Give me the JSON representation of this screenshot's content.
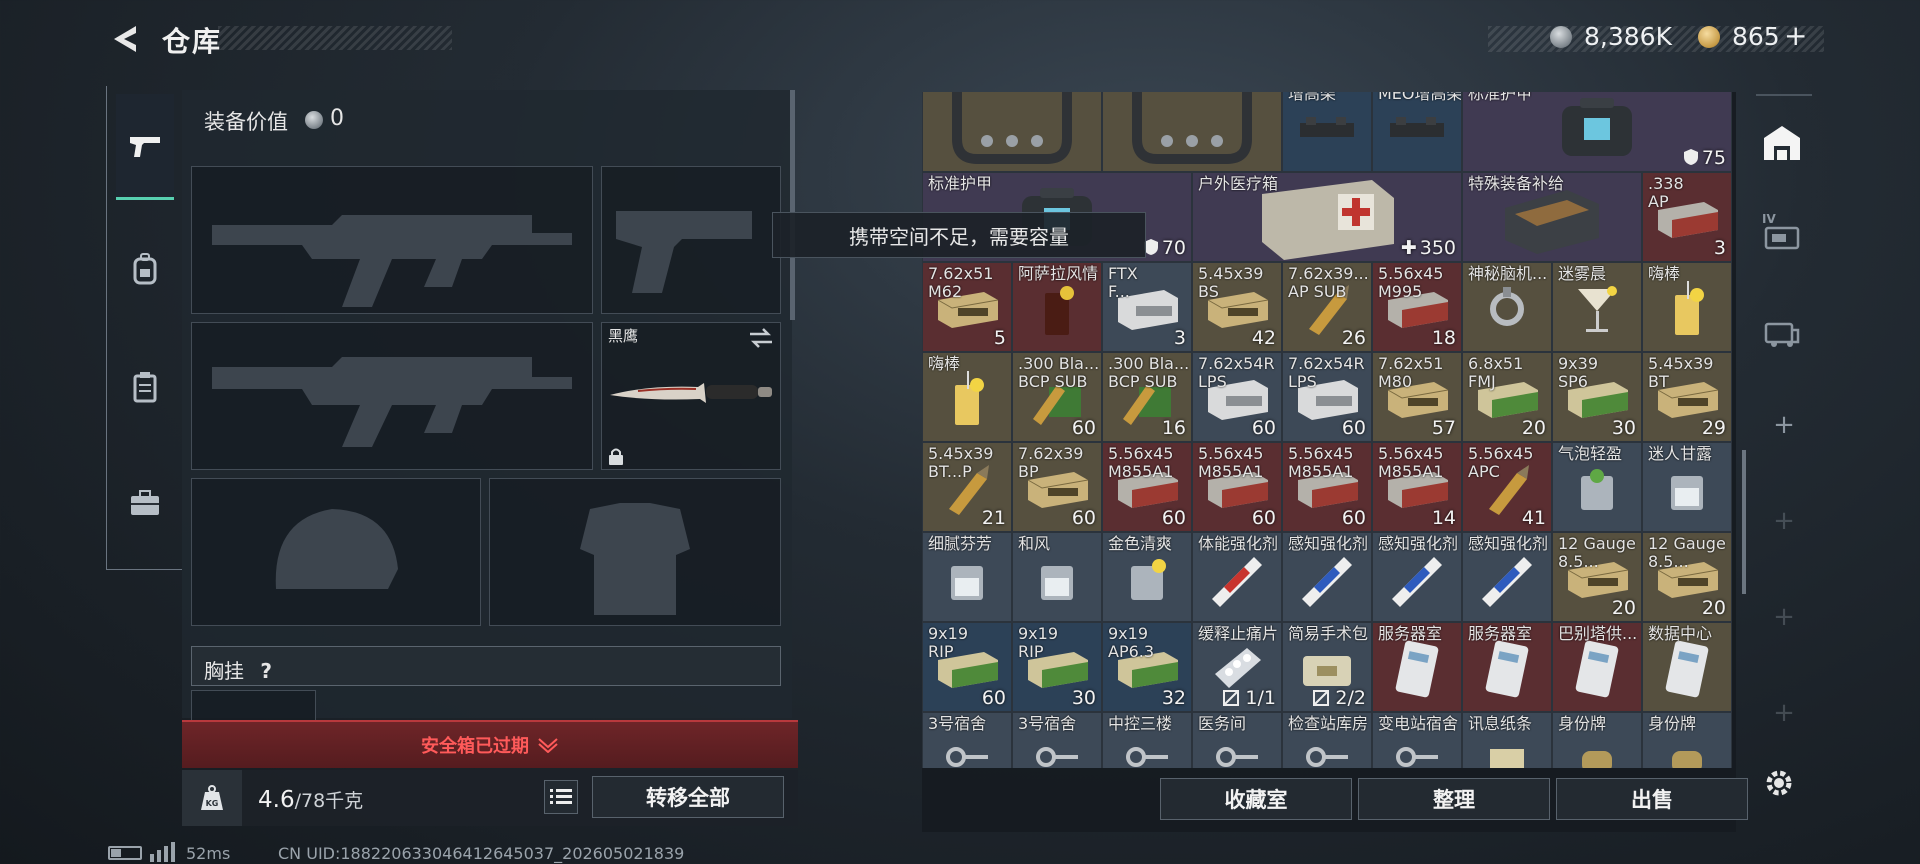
{
  "header": {
    "title": "仓库",
    "currency_silver": "8,386K",
    "currency_gold": "865",
    "gold_plus": "+"
  },
  "tabs": [
    {
      "icon": "pistol-icon",
      "active": true
    },
    {
      "icon": "backpack-icon",
      "active": false
    },
    {
      "icon": "vest-icon",
      "active": false
    },
    {
      "icon": "briefcase-icon",
      "active": false
    }
  ],
  "loadout": {
    "value_label": "装备价值",
    "value": "0",
    "melee_name": "黑鹰",
    "chest_rig_label": "胸挂",
    "help": "?"
  },
  "alert": {
    "text": "安全箱已过期"
  },
  "bottom": {
    "weight_current": "4.6",
    "weight_max": "/78千克",
    "transfer_all": "转移全部"
  },
  "tooltip": {
    "text": "携带空间不足，需要容量"
  },
  "warehouse": {
    "row0": [
      {
        "name": "",
        "count": "",
        "bg": "bg-olive",
        "icon": "rig"
      },
      {
        "name": "",
        "count": "",
        "bg": "bg-olive",
        "icon": "rig"
      },
      {
        "name": "增高架",
        "count": "",
        "bg": "bg-blue",
        "icon": "mount"
      },
      {
        "name": "MEO增高架",
        "count": "",
        "bg": "bg-blue",
        "icon": "mount"
      },
      {
        "name": "标准护甲",
        "count": "75",
        "bg": "bg-purple",
        "icon": "armor-bag"
      }
    ],
    "row1": [
      {
        "name": "标准护甲",
        "count": "70",
        "bg": "bg-purple",
        "icon": "armor-bag"
      },
      {
        "name": "户外医疗箱",
        "count": "350",
        "bg": "bg-purple",
        "icon": "medkit"
      },
      {
        "name": "特殊装备补给",
        "count": "",
        "bg": "bg-purple",
        "icon": "crate"
      },
      {
        "name": ".338\nAP",
        "count": "3",
        "bg": "bg-red",
        "icon": "ammo-box-red"
      }
    ],
    "rows": [
      [
        {
          "name": "7.62x51\nM62",
          "count": "5",
          "bg": "bg-red",
          "icon": "ammo-box"
        },
        {
          "name": "阿萨拉风情",
          "count": "",
          "bg": "bg-red",
          "icon": "drink-dark"
        },
        {
          "name": "FTX\nF...",
          "count": "3",
          "bg": "bg-gray",
          "icon": "ammo-box-white"
        },
        {
          "name": "5.45x39\nBS",
          "count": "42",
          "bg": "bg-olive",
          "icon": "ammo-box"
        },
        {
          "name": "7.62x39...\nAP SUB",
          "count": "26",
          "bg": "bg-olive",
          "icon": "round"
        },
        {
          "name": "5.56x45\nM995",
          "count": "18",
          "bg": "bg-red",
          "icon": "ammo-box-red"
        },
        {
          "name": "神秘脑机...",
          "count": "",
          "bg": "bg-olive",
          "icon": "device"
        },
        {
          "name": "迷雾晨",
          "count": "",
          "bg": "bg-olive",
          "icon": "cocktail"
        },
        {
          "name": "嗨棒",
          "count": "",
          "bg": "bg-olive",
          "icon": "drink-lemon"
        }
      ],
      [
        {
          "name": "嗨棒",
          "count": "",
          "bg": "bg-olive",
          "icon": "drink-lemon"
        },
        {
          "name": ".300 Bla...\nBCP SUB",
          "count": "60",
          "bg": "bg-olive",
          "icon": "round-green"
        },
        {
          "name": ".300 Bla...\nBCP SUB",
          "count": "16",
          "bg": "bg-olive",
          "icon": "round-green"
        },
        {
          "name": "7.62x54R\nLPS",
          "count": "60",
          "bg": "bg-gray",
          "icon": "ammo-box-white"
        },
        {
          "name": "7.62x54R\nLPS",
          "count": "60",
          "bg": "bg-gray",
          "icon": "ammo-box-white"
        },
        {
          "name": "7.62x51\nM80",
          "count": "57",
          "bg": "bg-olive",
          "icon": "ammo-box"
        },
        {
          "name": "6.8x51\nFMJ",
          "count": "20",
          "bg": "bg-olive",
          "icon": "ammo-box-green"
        },
        {
          "name": "9x39\nSP6",
          "count": "30",
          "bg": "bg-olive",
          "icon": "ammo-box-green"
        },
        {
          "name": "5.45x39\nBT",
          "count": "29",
          "bg": "bg-olive",
          "icon": "ammo-box"
        }
      ],
      [
        {
          "name": "5.45x39\nBT...P",
          "count": "21",
          "bg": "bg-olive",
          "icon": "round"
        },
        {
          "name": "7.62x39\nBP",
          "count": "60",
          "bg": "bg-olive",
          "icon": "ammo-box"
        },
        {
          "name": "5.56x45\nM855A1",
          "count": "60",
          "bg": "bg-red",
          "icon": "ammo-box-red"
        },
        {
          "name": "5.56x45\nM855A1",
          "count": "60",
          "bg": "bg-red",
          "icon": "ammo-box-red"
        },
        {
          "name": "5.56x45\nM855A1",
          "count": "60",
          "bg": "bg-red",
          "icon": "ammo-box-red"
        },
        {
          "name": "5.56x45\nM855A1",
          "count": "14",
          "bg": "bg-red",
          "icon": "ammo-box-red"
        },
        {
          "name": "5.56x45\nAPC",
          "count": "41",
          "bg": "bg-red",
          "icon": "round"
        },
        {
          "name": "气泡轻盈",
          "count": "",
          "bg": "bg-gray",
          "icon": "glass-mint"
        },
        {
          "name": "迷人甘露",
          "count": "",
          "bg": "bg-gray",
          "icon": "glass"
        }
      ],
      [
        {
          "name": "细腻芬芳",
          "count": "",
          "bg": "bg-gray",
          "icon": "glass"
        },
        {
          "name": "和风",
          "count": "",
          "bg": "bg-gray",
          "icon": "glass"
        },
        {
          "name": "金色清爽",
          "count": "",
          "bg": "bg-gray",
          "icon": "glass-lemon"
        },
        {
          "name": "体能强化剂",
          "count": "",
          "bg": "bg-gray",
          "icon": "syringe-red"
        },
        {
          "name": "感知强化剂",
          "count": "",
          "bg": "bg-gray",
          "icon": "syringe-blue"
        },
        {
          "name": "感知强化剂",
          "count": "",
          "bg": "bg-gray",
          "icon": "syringe-blue"
        },
        {
          "name": "感知强化剂",
          "count": "",
          "bg": "bg-gray",
          "icon": "syringe-blue"
        },
        {
          "name": "12 Gauge\n8.5...",
          "count": "20",
          "bg": "bg-olive",
          "icon": "ammo-box"
        },
        {
          "name": "12 Gauge\n8.5...",
          "count": "20",
          "bg": "bg-olive",
          "icon": "ammo-box"
        }
      ],
      [
        {
          "name": "9x19\nRIP",
          "count": "60",
          "bg": "bg-blue",
          "icon": "ammo-box-green"
        },
        {
          "name": "9x19\nRIP",
          "count": "30",
          "bg": "bg-blue",
          "icon": "ammo-box-green"
        },
        {
          "name": "9x19\nAP6.3",
          "count": "32",
          "bg": "bg-blue",
          "icon": "ammo-box-green"
        },
        {
          "name": "缓释止痛片",
          "count": "1/1",
          "bg": "bg-gray",
          "icon": "pills",
          "usage": true
        },
        {
          "name": "简易手术包",
          "count": "2/2",
          "bg": "bg-gray",
          "icon": "surgery-bag",
          "usage": true
        },
        {
          "name": "服务器室",
          "count": "",
          "bg": "bg-red",
          "icon": "keycard"
        },
        {
          "name": "服务器室",
          "count": "",
          "bg": "bg-red",
          "icon": "keycard"
        },
        {
          "name": "巴别塔供...",
          "count": "",
          "bg": "bg-red",
          "icon": "keycard"
        },
        {
          "name": "数据中心",
          "count": "",
          "bg": "bg-olive",
          "icon": "keycard"
        }
      ],
      [
        {
          "name": "3号宿舍",
          "count": "",
          "bg": "bg-gray",
          "icon": "key"
        },
        {
          "name": "3号宿舍",
          "count": "",
          "bg": "bg-gray",
          "icon": "key"
        },
        {
          "name": "中控三楼",
          "count": "",
          "bg": "bg-gray",
          "icon": "key"
        },
        {
          "name": "医务间",
          "count": "",
          "bg": "bg-gray",
          "icon": "key"
        },
        {
          "name": "检查站库房",
          "count": "",
          "bg": "bg-gray",
          "icon": "key"
        },
        {
          "name": "变电站宿舍",
          "count": "",
          "bg": "bg-gray",
          "icon": "key"
        },
        {
          "name": "讯息纸条",
          "count": "",
          "bg": "bg-gray",
          "icon": "note"
        },
        {
          "name": "身份牌",
          "count": "",
          "bg": "bg-gray",
          "icon": "tag"
        },
        {
          "name": "身份牌",
          "count": "",
          "bg": "bg-gray",
          "icon": "tag"
        }
      ]
    ]
  },
  "warehouse_buttons": {
    "collection": "收藏室",
    "organize": "整理",
    "sell": "出售"
  },
  "rail_badges": {
    "iv": "IV"
  },
  "footer": {
    "ping": "52ms",
    "uid": "CN UID:188220633046412645037_202605021839"
  },
  "colors": {
    "accent": "#58d0b0",
    "alert": "#ff5a5a"
  }
}
